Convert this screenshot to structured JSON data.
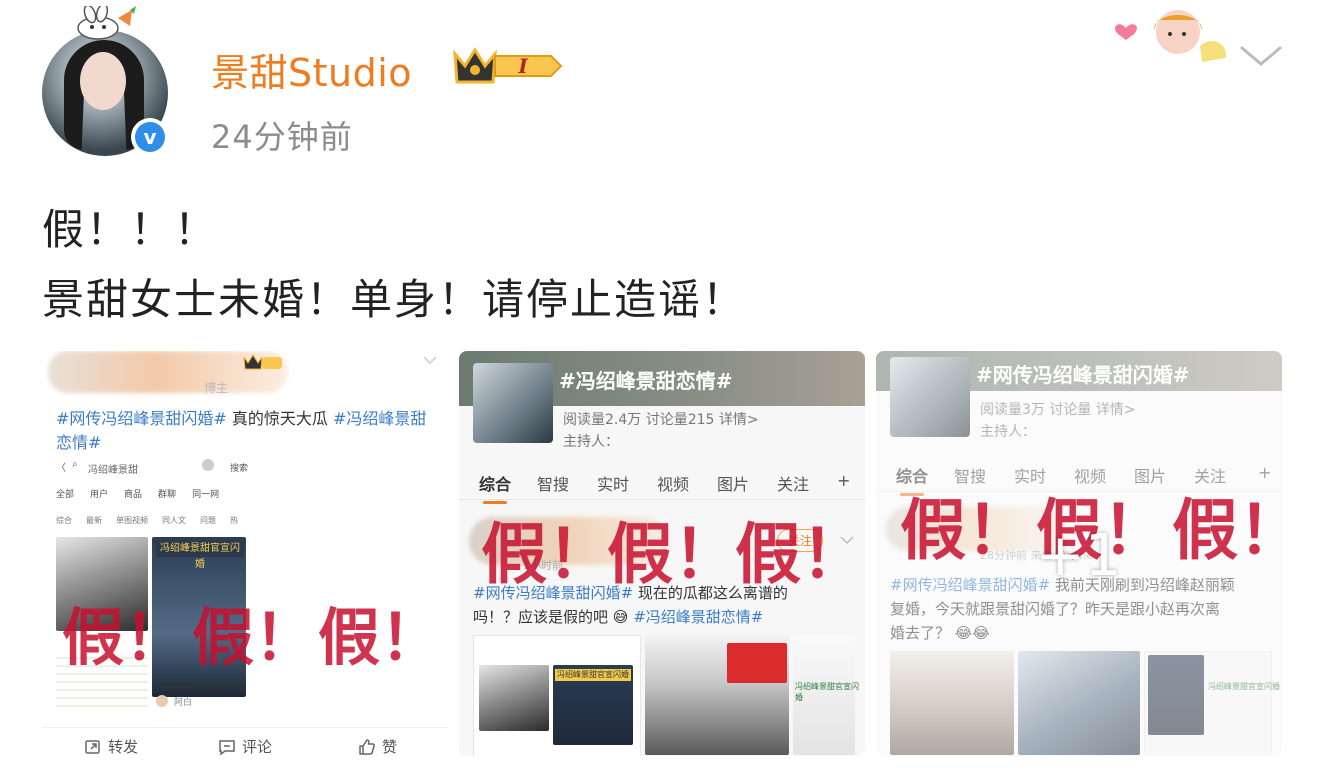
{
  "post": {
    "username": "景甜Studio",
    "level_badge": "I",
    "timestamp": "24分钟前",
    "text_line1": "假！！！",
    "text_line2": "景甜女士未婚！单身！请停止造谣！"
  },
  "tile1": {
    "caption_hash1": "#网传冯绍峰景甜闪婚#",
    "caption_plain": " 真的惊天大瓜 ",
    "caption_hash2": "#冯绍峰景甜恋情#",
    "search_text": "冯绍峰景甜",
    "search_btn": "搜索",
    "filters": [
      "全部",
      "用户",
      "商品",
      "群聊",
      "同一网"
    ],
    "subtabs": [
      "综合",
      "最新",
      "单图视频",
      "同人文",
      "问题",
      "热"
    ],
    "fake_text": [
      "假！",
      "假！",
      "假！"
    ],
    "image_caption": "冯绍峰景甜官宣闪婚",
    "small_author": "阿白",
    "blurred_badge": "博主"
  },
  "tile2": {
    "topic": "#冯绍峰景甜恋情#",
    "stats": "阅读量2.4万  讨论量215  详情>",
    "host": "主持人：",
    "tabs": [
      "综合",
      "智搜",
      "实时",
      "视频",
      "图片",
      "关注",
      "+"
    ],
    "follow": "关注",
    "meta": "1小时前",
    "caption_hash1": "#网传冯绍峰景甜闪婚#",
    "caption_plain1": " 现在的瓜都这么离谱的",
    "caption_plain2": "吗！？应该是假的吧",
    "caption_hash2": "#冯绍峰景甜恋情#",
    "fake_text": [
      "假！",
      "假！",
      "假！"
    ],
    "mini_caption1": "冯绍峰景甜官宣闪婚",
    "mini_caption2": "冯绍峰景甜官宣闪婚"
  },
  "tile3": {
    "topic": "#网传冯绍峰景甜闪婚#",
    "stats": "阅读量3万  讨论量  详情>",
    "host": "主持人：",
    "tabs": [
      "综合",
      "智搜",
      "实时",
      "视频",
      "图片",
      "关注",
      "+"
    ],
    "meta": "28分钟前 来自 iPhone",
    "caption_hash1": "#网传冯绍峰景甜闪婚#",
    "caption_plain1": " 我前天刚刷到冯绍峰赵丽颖",
    "caption_plain2": "复婚，今天就跟景甜闪婚了？昨天是跟小赵再次离",
    "caption_plain3": "婚去了？",
    "fake_text": [
      "假！",
      "假！",
      "假！"
    ],
    "more_count": "+1",
    "mini_caption": "冯绍峰景甜官宣闪婚"
  },
  "actions": {
    "repost": "转发",
    "comment": "评论",
    "like": "赞"
  },
  "colors": {
    "username": "#ef7c1f",
    "hashtag": "#3a7cc7",
    "fake_red": "#c8102e",
    "verified_blue": "#2f8ee8"
  }
}
